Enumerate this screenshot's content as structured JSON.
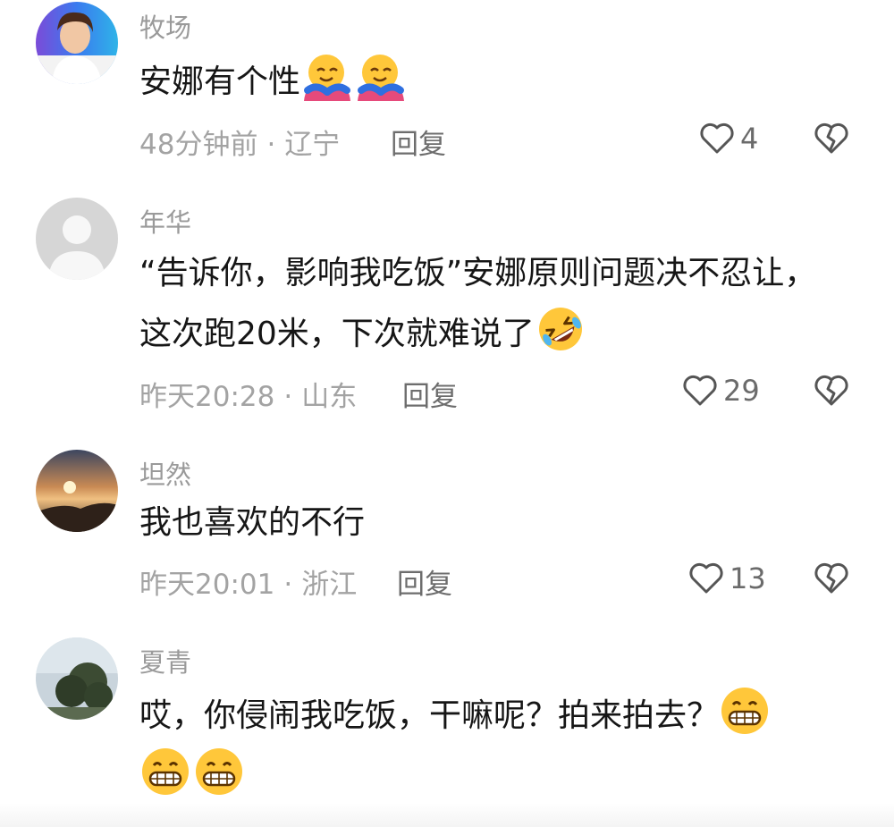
{
  "comments": [
    {
      "username": "牧场",
      "text": "安娜有个性",
      "emojis_after_text": [
        "hug-emoji",
        "hug-emoji"
      ],
      "time": "48分钟前",
      "location": "辽宁",
      "reply_label": "回复",
      "likes": "4"
    },
    {
      "username": "年华",
      "text_line1": "“告诉你，影响我吃饭”安娜原则问题决不忍让，",
      "text_line2": "这次跑20米，下次就难说了",
      "emojis_after_text": [
        "rolling-laugh-emoji"
      ],
      "time": "昨天20:28",
      "location": "山东",
      "reply_label": "回复",
      "likes": "29"
    },
    {
      "username": "坦然",
      "text": "我也喜欢的不行",
      "time": "昨天20:01",
      "location": "浙江",
      "reply_label": "回复",
      "likes": "13"
    },
    {
      "username": "夏青",
      "text": "哎，你侵闹我吃饭，干嘛呢？拍来拍去？",
      "emojis_after_text": [
        "grin-emoji",
        "grin-emoji",
        "grin-emoji"
      ]
    }
  ],
  "separator": "·",
  "icons": {
    "like": "heart-outline-icon",
    "dislike": "broken-heart-icon"
  },
  "colors": {
    "username": "#9a9a9a",
    "text": "#161616",
    "meta": "#a3a3a3",
    "reply": "#6d6d6d"
  }
}
